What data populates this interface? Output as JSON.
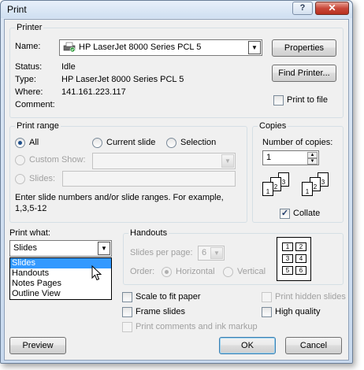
{
  "window": {
    "title": "Print",
    "help": "?",
    "close": "✕"
  },
  "printer": {
    "group_label": "Printer",
    "name_label": "Name:",
    "name_value": "HP LaserJet 8000 Series PCL 5",
    "properties_button": "Properties",
    "status_label": "Status:",
    "status_value": "Idle",
    "type_label": "Type:",
    "type_value": "HP LaserJet 8000 Series PCL 5",
    "where_label": "Where:",
    "where_value": "141.161.223.117",
    "comment_label": "Comment:",
    "find_button": "Find Printer...",
    "print_to_file": "Print to file"
  },
  "print_range": {
    "group_label": "Print range",
    "all": "All",
    "current_slide": "Current slide",
    "selection": "Selection",
    "custom_show": "Custom Show:",
    "slides": "Slides:",
    "hint": "Enter slide numbers and/or slide ranges. For example, 1,3,5-12"
  },
  "copies": {
    "group_label": "Copies",
    "number_label": "Number of copies:",
    "number_value": "1",
    "collate": "Collate"
  },
  "print_what": {
    "label": "Print what:",
    "value": "Slides",
    "options": [
      "Slides",
      "Handouts",
      "Notes Pages",
      "Outline View"
    ]
  },
  "handouts": {
    "group_label": "Handouts",
    "slides_per_page_label": "Slides per page:",
    "slides_per_page_value": "6",
    "order_label": "Order:",
    "horizontal": "Horizontal",
    "vertical": "Vertical",
    "preview_numbers": [
      "1",
      "2",
      "3",
      "4",
      "5",
      "6"
    ]
  },
  "options": {
    "scale_to_fit": "Scale to fit paper",
    "frame_slides": "Frame slides",
    "print_comments": "Print comments and ink markup",
    "print_hidden": "Print hidden slides",
    "high_quality": "High quality"
  },
  "buttons": {
    "preview": "Preview",
    "ok": "OK",
    "cancel": "Cancel"
  },
  "collate_pages": [
    "1",
    "2",
    "3"
  ],
  "icons": {
    "printer": "printer-icon",
    "cursor": "mouse-cursor-icon"
  }
}
